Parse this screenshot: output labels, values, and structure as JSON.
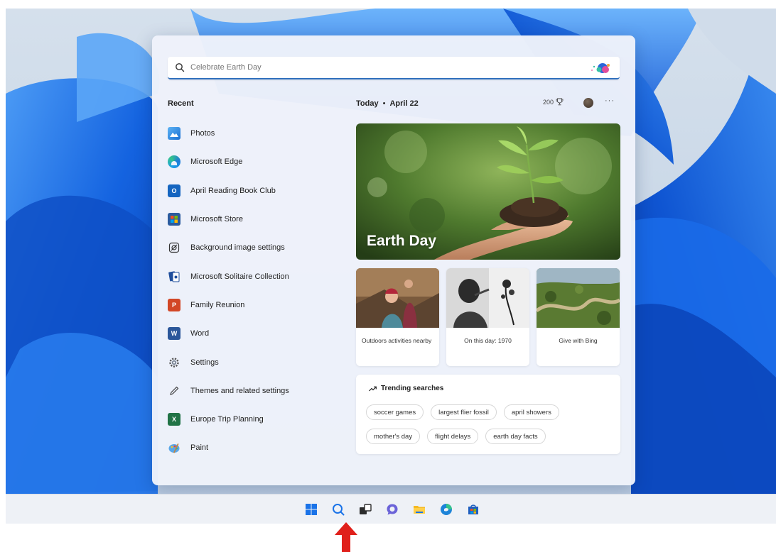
{
  "search": {
    "placeholder": "Celebrate Earth Day"
  },
  "recent": {
    "header": "Recent",
    "items": [
      {
        "label": "Photos",
        "icon": "photos-icon"
      },
      {
        "label": "Microsoft Edge",
        "icon": "edge-icon"
      },
      {
        "label": "April Reading Book Club",
        "icon": "outlook-icon"
      },
      {
        "label": "Microsoft Store",
        "icon": "store-icon"
      },
      {
        "label": "Background image settings",
        "icon": "image-settings-icon"
      },
      {
        "label": "Microsoft Solitaire Collection",
        "icon": "solitaire-icon"
      },
      {
        "label": "Family Reunion",
        "icon": "powerpoint-icon"
      },
      {
        "label": "Word",
        "icon": "word-icon"
      },
      {
        "label": "Settings",
        "icon": "settings-gear-icon"
      },
      {
        "label": "Themes and related settings",
        "icon": "pen-icon"
      },
      {
        "label": "Europe Trip Planning",
        "icon": "excel-icon"
      },
      {
        "label": "Paint",
        "icon": "paint-icon"
      }
    ]
  },
  "today": {
    "label": "Today",
    "separator": "•",
    "date": "April 22",
    "points": "200",
    "more": "···"
  },
  "hero": {
    "title": "Earth Day"
  },
  "cards": [
    {
      "label": "Outdoors activities nearby"
    },
    {
      "label": "On this day: 1970"
    },
    {
      "label": "Give with Bing"
    }
  ],
  "trending": {
    "title": "Trending searches",
    "rows": [
      [
        "soccer games",
        "largest flier fossil",
        "april showers"
      ],
      [
        "mother's day",
        "flight delays",
        "earth day facts"
      ]
    ]
  },
  "taskbar": {
    "icons": [
      "start-icon",
      "search-icon",
      "task-view-icon",
      "chat-icon",
      "file-explorer-icon",
      "edge-icon",
      "store-icon"
    ]
  },
  "colors": {
    "accent": "#2f6fbd",
    "arrow": "#e0201b",
    "wallpaper_blue": "#1a5fd8"
  }
}
